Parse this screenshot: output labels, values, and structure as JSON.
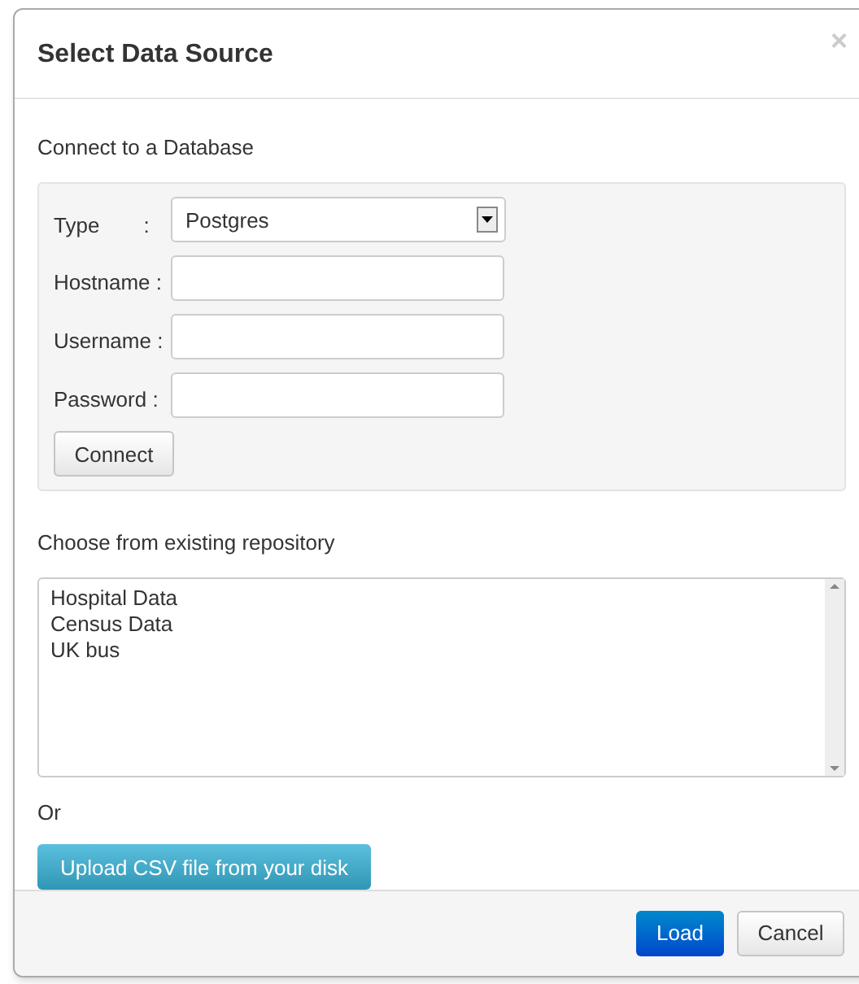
{
  "dialog": {
    "title": "Select Data Source",
    "close": "×"
  },
  "database": {
    "heading": "Connect to a Database",
    "type_field": {
      "label": "Type",
      "separator": ":",
      "value": "Postgres"
    },
    "fields": [
      {
        "label": "Hostname :"
      },
      {
        "label": "Username :"
      },
      {
        "label": "Password :"
      }
    ],
    "connect_button": "Connect"
  },
  "repository": {
    "heading": "Choose from existing repository",
    "items": [
      "Hospital Data",
      "Census Data",
      "UK bus"
    ]
  },
  "or_text": "Or",
  "upload_button": "Upload CSV file from your disk",
  "footer": {
    "buttons": [
      {
        "label": "Load",
        "kind": "primary"
      },
      {
        "label": "Cancel",
        "kind": "default"
      }
    ]
  }
}
